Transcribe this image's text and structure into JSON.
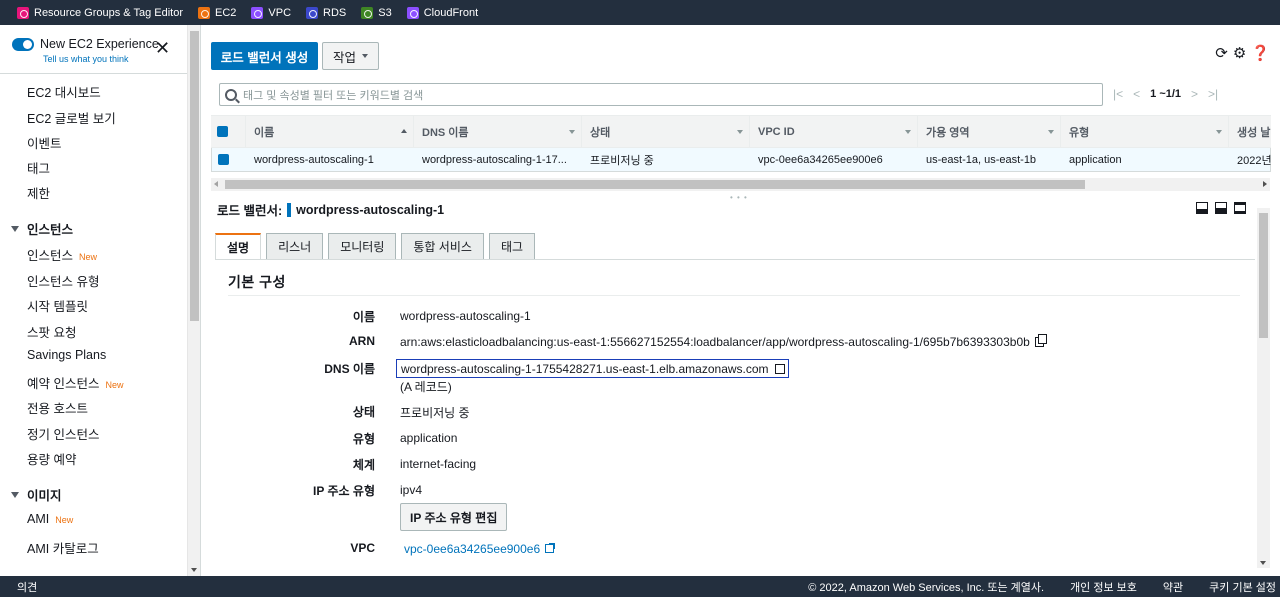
{
  "favorites": [
    {
      "label": "Resource Groups & Tag Editor",
      "color": "#e7157b",
      "icon": "resource-groups-icon"
    },
    {
      "label": "EC2",
      "color": "#ec7211",
      "icon": "ec2-icon"
    },
    {
      "label": "VPC",
      "color": "#8c4fff",
      "icon": "vpc-icon"
    },
    {
      "label": "RDS",
      "color": "#3b48cc",
      "icon": "rds-icon"
    },
    {
      "label": "S3",
      "color": "#3f8624",
      "icon": "s3-icon"
    },
    {
      "label": "CloudFront",
      "color": "#8c4fff",
      "icon": "cloudfront-icon"
    }
  ],
  "sidebar": {
    "experience_title": "New EC2 Experience",
    "experience_link": "Tell us what you think",
    "items": [
      {
        "label": "EC2 대시보드"
      },
      {
        "label": "EC2 글로벌 보기"
      },
      {
        "label": "이벤트"
      },
      {
        "label": "태그"
      },
      {
        "label": "제한"
      }
    ],
    "section_instances": "인스턴스",
    "instance_items": [
      {
        "label": "인스턴스",
        "badge": "New"
      },
      {
        "label": "인스턴스 유형"
      },
      {
        "label": "시작 템플릿"
      },
      {
        "label": "스팟 요청"
      },
      {
        "label": "Savings Plans"
      },
      {
        "label": "예약 인스턴스",
        "badge": "New"
      },
      {
        "label": "전용 호스트"
      },
      {
        "label": "정기 인스턴스"
      },
      {
        "label": "용량 예약"
      }
    ],
    "section_images": "이미지",
    "image_items": [
      {
        "label": "AMI",
        "badge": "New"
      },
      {
        "label": "AMI 카탈로그"
      }
    ]
  },
  "toolbar": {
    "create_button": "로드 밸런서 생성",
    "actions_button": "작업"
  },
  "search": {
    "placeholder": "태그 및 속성별 필터 또는 키워드별 검색"
  },
  "pager": {
    "text": "1 ~1/1"
  },
  "table": {
    "columns": [
      "이름",
      "DNS 이름",
      "상태",
      "VPC ID",
      "가용 영역",
      "유형",
      "생성 날"
    ],
    "row": {
      "name": "wordpress-autoscaling-1",
      "dns": "wordpress-autoscaling-1-17...",
      "state": "프로비저닝 중",
      "vpc": "vpc-0ee6a34265ee900e6",
      "az": "us-east-1a, us-east-1b",
      "type": "application",
      "created": "2022년"
    }
  },
  "detail": {
    "prefix": "로드 밸런서:",
    "name": "wordpress-autoscaling-1",
    "tabs": [
      "설명",
      "리스너",
      "모니터링",
      "통합 서비스",
      "태그"
    ],
    "section_title": "기본 구성",
    "labels": {
      "name": "이름",
      "arn": "ARN",
      "dns": "DNS 이름",
      "state": "상태",
      "type": "유형",
      "scheme": "체계",
      "ip_type": "IP 주소 유형",
      "vpc": "VPC"
    },
    "values": {
      "name": "wordpress-autoscaling-1",
      "arn": "arn:aws:elasticloadbalancing:us-east-1:556627152554:loadbalancer/app/wordpress-autoscaling-1/695b7b6393303b0b",
      "dns": "wordpress-autoscaling-1-1755428271.us-east-1.elb.amazonaws.com",
      "dns_note": "(A 레코드)",
      "state": "프로비저닝 중",
      "type": "application",
      "scheme": "internet-facing",
      "ip_type": "ipv4",
      "vpc": "vpc-0ee6a34265ee900e6"
    },
    "edit_ip_button": "IP 주소 유형 편집"
  },
  "footer": {
    "feedback": "의견",
    "copyright": "© 2022, Amazon Web Services, Inc. 또는 계열사.",
    "privacy": "개인 정보 보호",
    "terms": "약관",
    "cookies": "쿠키 기본 설정"
  }
}
